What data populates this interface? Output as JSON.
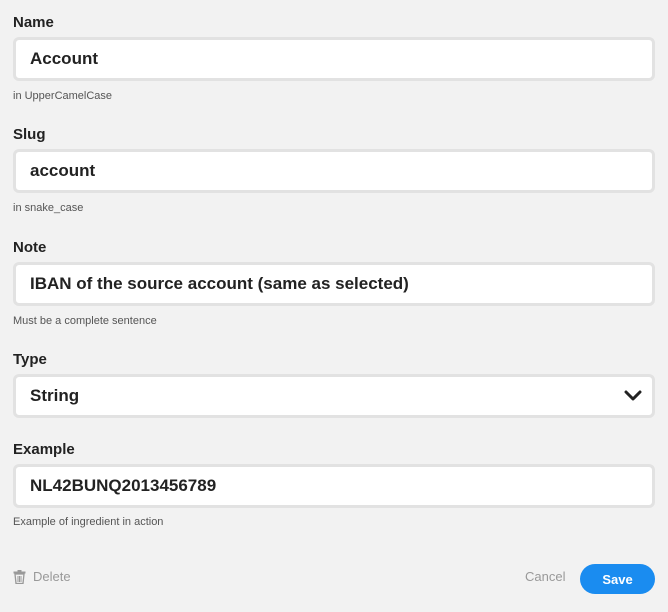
{
  "fields": {
    "name": {
      "label": "Name",
      "value": "Account",
      "hint": "in UpperCamelCase"
    },
    "slug": {
      "label": "Slug",
      "value": "account",
      "hint": "in snake_case"
    },
    "note": {
      "label": "Note",
      "value": "IBAN of the source account (same as selected)",
      "hint": "Must be a complete sentence"
    },
    "type": {
      "label": "Type",
      "value": "String",
      "icon": "chevron-down-icon"
    },
    "example": {
      "label": "Example",
      "value": "NL42BUNQ2013456789",
      "hint": "Example of ingredient in action"
    }
  },
  "actions": {
    "delete_label": "Delete",
    "delete_icon": "trash-icon",
    "cancel_label": "Cancel",
    "save_label": "Save"
  },
  "colors": {
    "accent": "#1a8cf0",
    "background": "#f2f2f2",
    "input_border": "#e2e2e2",
    "muted_text": "#999999"
  }
}
